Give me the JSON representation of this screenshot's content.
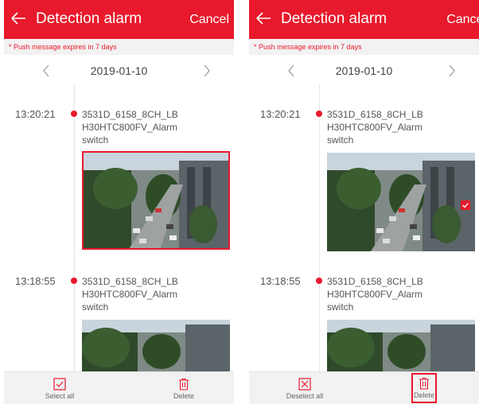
{
  "panels": [
    {
      "header": {
        "title": "Detection alarm",
        "cancel_label": "Cancel"
      },
      "notice": "* Push message expires in 7 days",
      "date_nav": {
        "date": "2019-01-10"
      },
      "entries": [
        {
          "time": "13:20:21",
          "line1": "3531D_6158_8CH_LB",
          "line2": "H30HTC800FV_Alarm",
          "line3": "switch"
        },
        {
          "time": "13:18:55",
          "line1": "3531D_6158_8CH_LB",
          "line2": "H30HTC800FV_Alarm",
          "line3": "switch"
        }
      ],
      "bottom": {
        "left_label": "Select all",
        "right_label": "Delete"
      }
    },
    {
      "header": {
        "title": "Detection alarm",
        "cancel_label": "Cancel"
      },
      "notice": "* Push message expires in 7 days",
      "date_nav": {
        "date": "2019-01-10"
      },
      "entries": [
        {
          "time": "13:20:21",
          "line1": "3531D_6158_8CH_LB",
          "line2": "H30HTC800FV_Alarm",
          "line3": "switch"
        },
        {
          "time": "13:18:55",
          "line1": "3531D_6158_8CH_LB",
          "line2": "H30HTC800FV_Alarm",
          "line3": "switch"
        }
      ],
      "bottom": {
        "left_label": "Deselect all",
        "right_label": "Delete"
      }
    }
  ],
  "colors": {
    "accent": "#e8192c",
    "bar": "#f2f2f2"
  },
  "icons": {
    "back": "back-arrow-icon",
    "prev": "chevron-left-icon",
    "next": "chevron-right-icon",
    "select_all": "checkbox-icon",
    "deselect_all": "x-box-icon",
    "delete": "trash-icon",
    "selected": "check-badge-icon"
  }
}
